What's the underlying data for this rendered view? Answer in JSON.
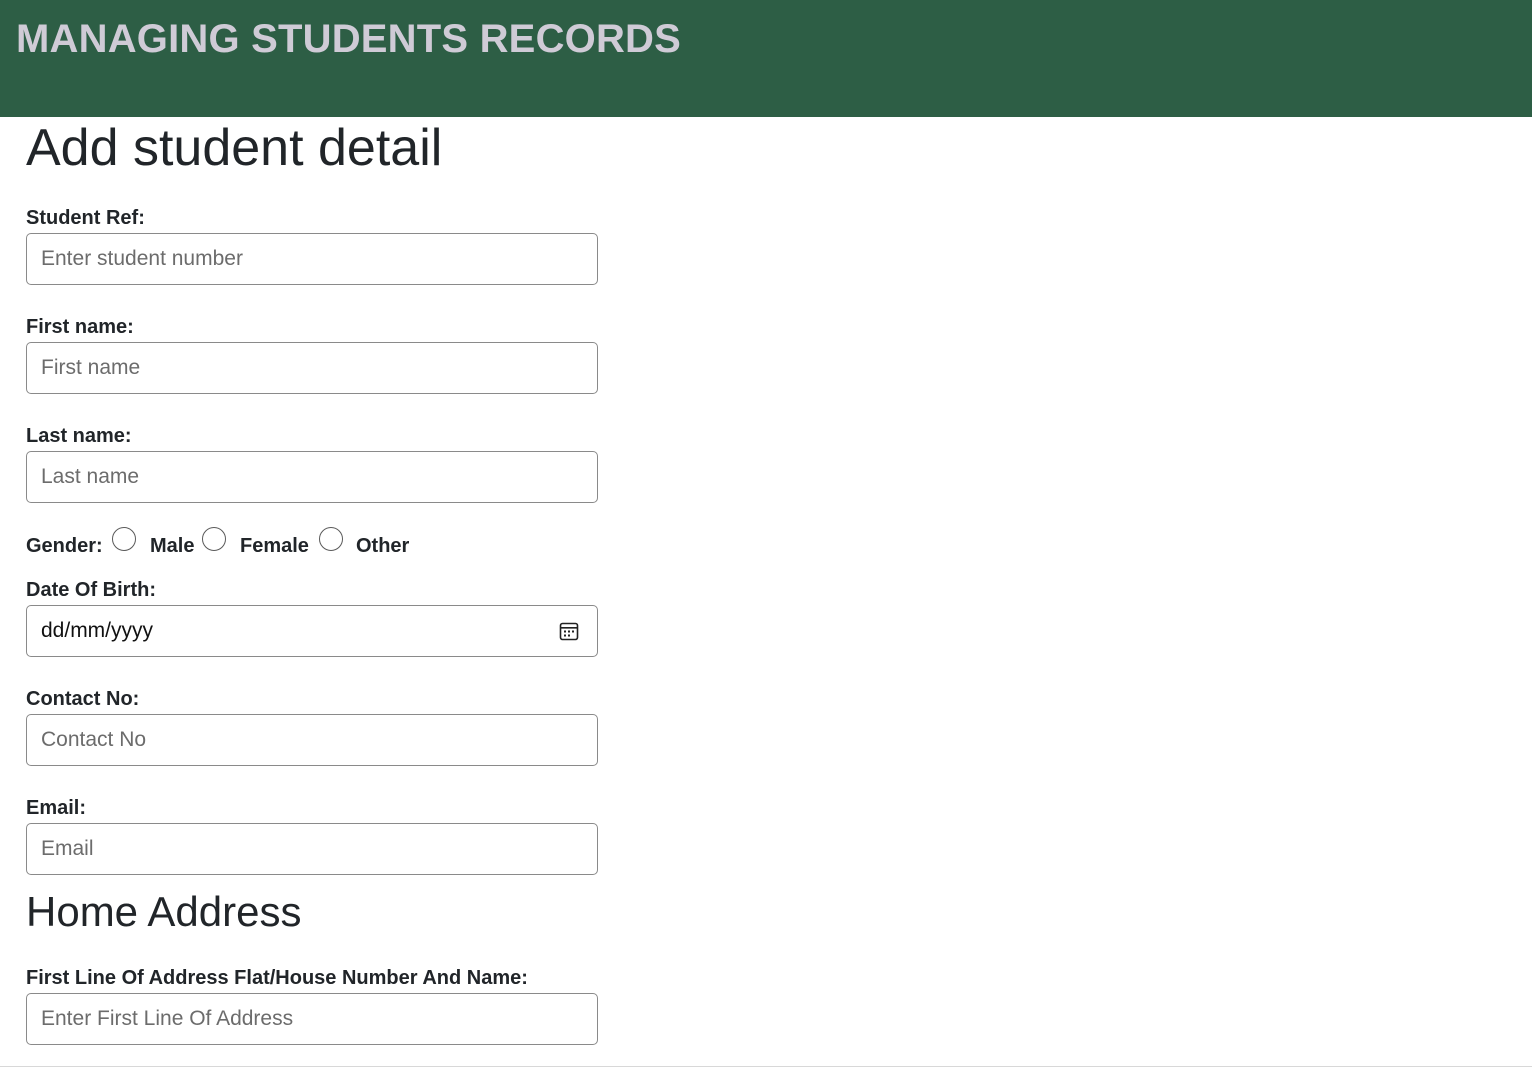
{
  "header": {
    "title": "MANAGING STUDENTS RECORDS"
  },
  "form": {
    "title": "Add student detail",
    "student_ref": {
      "label": "Student Ref:",
      "placeholder": "Enter student number"
    },
    "first_name": {
      "label": "First name:",
      "placeholder": "First name"
    },
    "last_name": {
      "label": "Last name:",
      "placeholder": "Last name"
    },
    "gender": {
      "label": "Gender:",
      "options": [
        "Male",
        "Female",
        "Other"
      ]
    },
    "dob": {
      "label": "Date Of Birth:",
      "value": "dd/mm/yyyy",
      "icon": "calendar-icon"
    },
    "contact": {
      "label": "Contact No:",
      "placeholder": "Contact No"
    },
    "email": {
      "label": "Email:",
      "placeholder": "Email"
    }
  },
  "address": {
    "title": "Home Address",
    "line1": {
      "label": "First Line Of Address Flat/House Number And Name:",
      "placeholder": "Enter First Line Of Address"
    }
  },
  "colors": {
    "header_bg": "#2d5e45",
    "header_text": "#cfcbd6"
  }
}
